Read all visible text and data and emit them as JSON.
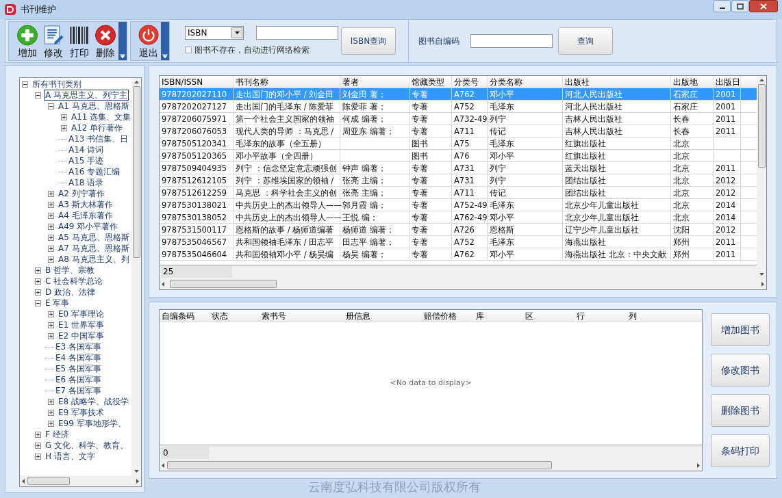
{
  "window": {
    "title": "书刊维护"
  },
  "toolbar": {
    "buttons": [
      {
        "kind": "add",
        "label": "增加"
      },
      {
        "kind": "edit",
        "label": "修改"
      },
      {
        "kind": "print",
        "label": "打印"
      },
      {
        "kind": "delete",
        "label": "删除"
      }
    ],
    "exit_button": {
      "kind": "exit",
      "label": "退出"
    }
  },
  "search": {
    "field_type": "ISBN",
    "auto_search": {
      "label": "图书不存在，自动进行网络检索",
      "checked": false
    },
    "isbn_button": "ISBN查询",
    "code_label": "图书自编码",
    "query_button": "查询"
  },
  "tree": [
    {
      "label": "所有书刊类别",
      "expanded": true,
      "selected": false,
      "children": [
        {
          "label": "A 马克思主义、列宁主",
          "expanded": true,
          "selected": true,
          "children": [
            {
              "label": "A1 马克思、恩格斯",
              "expanded": true,
              "selected": false,
              "children": [
                {
                  "label": "A11 选集、文集",
                  "expanded": false,
                  "selected": false
                },
                {
                  "label": "A12 单行著作",
                  "expanded": false,
                  "selected": false
                },
                {
                  "label": "A13 书信集、日",
                  "selected": false
                },
                {
                  "label": "A14 诗词",
                  "selected": false
                },
                {
                  "label": "A15 手迹",
                  "selected": false
                },
                {
                  "label": "A16 专题汇编",
                  "selected": false
                },
                {
                  "label": "A18 语录",
                  "selected": false
                }
              ]
            },
            {
              "label": "A2 列宁著作",
              "expanded": false,
              "selected": false
            },
            {
              "label": "A3 斯大林著作",
              "expanded": false,
              "selected": false
            },
            {
              "label": "A4 毛泽东著作",
              "expanded": false,
              "selected": false
            },
            {
              "label": "A49 邓小平著作",
              "expanded": false,
              "selected": false
            },
            {
              "label": "A5 马克思、恩格斯",
              "expanded": false,
              "selected": false
            },
            {
              "label": "A7 马克思、恩格斯",
              "expanded": false,
              "selected": false
            },
            {
              "label": "A8 马克思主义、列",
              "expanded": false,
              "selected": false
            }
          ]
        },
        {
          "label": "B 哲学、宗教",
          "expanded": false,
          "selected": false
        },
        {
          "label": "C 社会科学总论",
          "expanded": false,
          "selected": false
        },
        {
          "label": "D 政治、法律",
          "expanded": false,
          "selected": false
        },
        {
          "label": "E 军事",
          "expanded": true,
          "selected": false,
          "children": [
            {
              "label": "E0 军事理论",
              "expanded": false,
              "selected": false
            },
            {
              "label": "E1 世界军事",
              "expanded": false,
              "selected": false
            },
            {
              "label": "E2 中国军事",
              "expanded": false,
              "selected": false
            },
            {
              "label": "E3 各国军事",
              "selected": false
            },
            {
              "label": "E4 各国军事",
              "selected": false
            },
            {
              "label": "E5 各国军事",
              "selected": false
            },
            {
              "label": "E6 各国军事",
              "selected": false
            },
            {
              "label": "E7 各国军事",
              "selected": false
            },
            {
              "label": "E8 战略学、战役学",
              "expanded": false,
              "selected": false
            },
            {
              "label": "E9 军事技术",
              "expanded": false,
              "selected": false
            },
            {
              "label": "E99 军事地形学、",
              "expanded": false,
              "selected": false
            }
          ]
        },
        {
          "label": "F 经济",
          "expanded": false,
          "selected": false
        },
        {
          "label": "G 文化、科学、教育、",
          "expanded": false,
          "selected": false
        },
        {
          "label": "H 语言、文字",
          "expanded": false,
          "selected": false
        }
      ]
    }
  ],
  "books_table": {
    "columns": [
      "ISBN/ISSN",
      "书刊名称",
      "著者",
      "馆藏类型",
      "分类号",
      "分类名称",
      "出版社",
      "出版地",
      "出版日"
    ],
    "rows": [
      {
        "selected": true,
        "cells": [
          "9787202027110",
          "走出国门的邓小平 / 刘金田",
          "刘金田 著；",
          "专著",
          "A762",
          "邓小平",
          "河北人民出版社",
          "石家庄",
          "2001"
        ]
      },
      {
        "selected": false,
        "cells": [
          "9787202027127",
          "走出国门的毛泽东 / 陈爱菲",
          "陈爱菲 著；",
          "专著",
          "A752",
          "毛泽东",
          "河北人民出版社",
          "石家庄",
          "2001"
        ]
      },
      {
        "selected": false,
        "cells": [
          "9787206075971",
          "第一个社会主义国家的领袖",
          "何成 编著；",
          "专著",
          "A732-49",
          "列宁",
          "吉林人民出版社",
          "长春",
          "2011"
        ]
      },
      {
        "selected": false,
        "cells": [
          "9787206076053",
          "现代人类的导师 ：马克思 /",
          "周亚东 编著；",
          "专著",
          "A711",
          "传记",
          "吉林人民出版社",
          "长春",
          "2011"
        ]
      },
      {
        "selected": false,
        "cells": [
          "9787505120341",
          "毛泽东的故事（全五册）",
          "",
          "图书",
          "A75",
          "毛泽东",
          "红旗出版社",
          "北京",
          ""
        ]
      },
      {
        "selected": false,
        "cells": [
          "9787505120365",
          "邓小平故事（全四册）",
          "",
          "图书",
          "A76",
          "邓小平",
          "红旗出版社",
          "北京",
          ""
        ]
      },
      {
        "selected": false,
        "cells": [
          "9787509404935",
          "列宁 ：信念坚定意志顽强创",
          "钟声 编著；",
          "专著",
          "A731",
          "列宁",
          "蓝天出版社",
          "北京",
          "2011"
        ]
      },
      {
        "selected": false,
        "cells": [
          "9787512612105",
          "列宁 ：苏维埃国家的领袖 /",
          "张亮 主编；",
          "专著",
          "A731",
          "列宁",
          "团结出版社",
          "北京",
          "2012"
        ]
      },
      {
        "selected": false,
        "cells": [
          "9787512612259",
          "马克思 ：科学社会主义的创",
          "张亮 主编；",
          "专著",
          "A711",
          "传记",
          "团结出版社",
          "北京",
          "2012"
        ]
      },
      {
        "selected": false,
        "cells": [
          "9787530138021",
          "中共历史上的杰出领导人——",
          "郭月霞 编；",
          "专著",
          "A752-49",
          "毛泽东",
          "北京少年儿童出版社",
          "北京",
          "2014"
        ]
      },
      {
        "selected": false,
        "cells": [
          "9787530138052",
          "中共历史上的杰出领导人——",
          "王悦 编；",
          "专著",
          "A762-49",
          "邓小平",
          "北京少年儿童出版社",
          "北京",
          "2014"
        ]
      },
      {
        "selected": false,
        "cells": [
          "9787531500117",
          "恩格斯的故事 / 杨师道编著",
          "杨师道 编著；",
          "专著",
          "A726",
          "恩格斯",
          "辽宁少年儿童出版社",
          "沈阳",
          "2012"
        ]
      },
      {
        "selected": false,
        "cells": [
          "9787535046567",
          "共和国领袖毛泽东 / 田志平",
          "田志平 编著；",
          "专著",
          "A752",
          "毛泽东",
          "海燕出版社",
          "郑州",
          "2011"
        ]
      },
      {
        "selected": false,
        "cells": [
          "9787535046604",
          "共和国领袖邓小平 / 杨昊编",
          "杨昊 编著；",
          "专著",
          "A762",
          "邓小平",
          "海燕出版社 北京：中央文献",
          "郑州",
          "2011"
        ]
      }
    ],
    "footer_count": "25"
  },
  "copies_table": {
    "columns": [
      "自编条码",
      "状态",
      "索书号",
      "册信息",
      "赔偿价格",
      "库",
      "区",
      "行",
      "列"
    ],
    "empty_message": "<No data to display>",
    "footer_count": "0"
  },
  "side_buttons": [
    "增加图书",
    "修改图书",
    "删除图书",
    "条码打印"
  ],
  "footer": "云南度弘科技有限公司版权所有"
}
